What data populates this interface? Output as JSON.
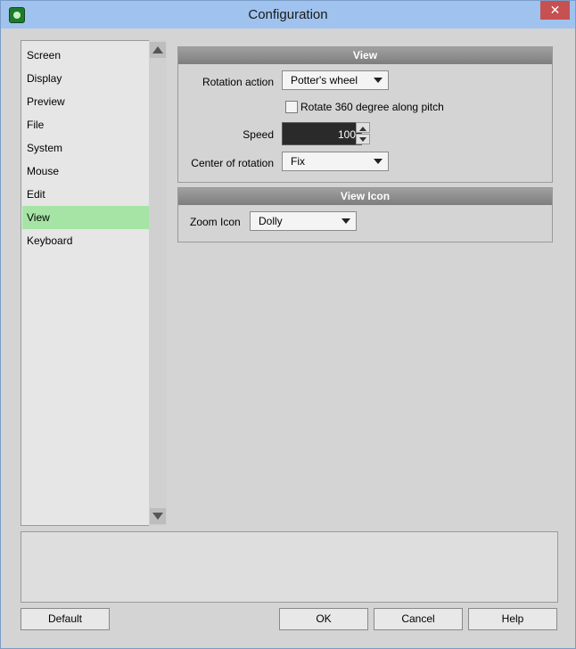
{
  "window": {
    "title": "Configuration",
    "close_glyph": "✕"
  },
  "sidebar": {
    "items": [
      {
        "label": "Screen",
        "selected": false
      },
      {
        "label": "Display",
        "selected": false
      },
      {
        "label": "Preview",
        "selected": false
      },
      {
        "label": "File",
        "selected": false
      },
      {
        "label": "System",
        "selected": false
      },
      {
        "label": "Mouse",
        "selected": false
      },
      {
        "label": "Edit",
        "selected": false
      },
      {
        "label": "View",
        "selected": true
      },
      {
        "label": "Keyboard",
        "selected": false
      }
    ]
  },
  "view_group": {
    "header": "View",
    "rotation_action_label": "Rotation action",
    "rotation_action_value": "Potter's wheel",
    "rotate_360_label": "Rotate 360 degree along pitch",
    "rotate_360_checked": false,
    "speed_label": "Speed",
    "speed_value": "100",
    "center_label": "Center of rotation",
    "center_value": "Fix"
  },
  "view_icon_group": {
    "header": "View Icon",
    "zoom_icon_label": "Zoom Icon",
    "zoom_icon_value": "Dolly"
  },
  "buttons": {
    "default": "Default",
    "ok": "OK",
    "cancel": "Cancel",
    "help": "Help"
  },
  "colors": {
    "titlebar": "#9fc3ee",
    "selected_item": "#a6e4a6",
    "group_header": "#8c8c8c",
    "close_button": "#c75050"
  }
}
